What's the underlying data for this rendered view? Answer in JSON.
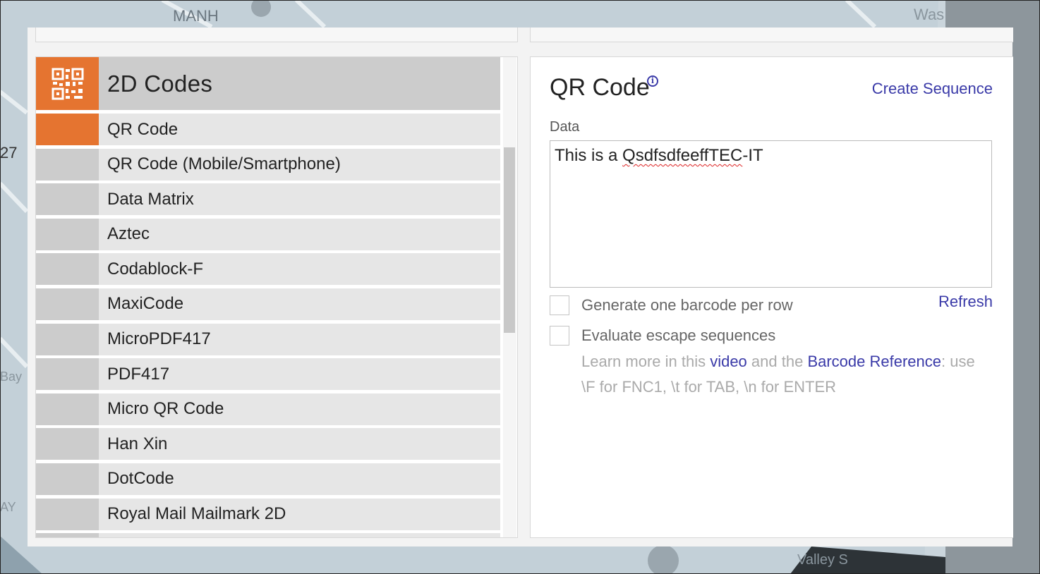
{
  "background": {
    "map_labels": [
      "MANH",
      "27",
      "Was",
      "Valley S",
      "Bay",
      "AY"
    ]
  },
  "category": {
    "title": "2D Codes",
    "icon": "qr-code-icon",
    "accent_color": "#e57430"
  },
  "code_list": [
    {
      "label": "QR Code",
      "selected": true
    },
    {
      "label": "QR Code (Mobile/Smartphone)",
      "selected": false
    },
    {
      "label": "Data Matrix",
      "selected": false
    },
    {
      "label": "Aztec",
      "selected": false
    },
    {
      "label": "Codablock-F",
      "selected": false
    },
    {
      "label": "MaxiCode",
      "selected": false
    },
    {
      "label": "MicroPDF417",
      "selected": false
    },
    {
      "label": "PDF417",
      "selected": false
    },
    {
      "label": "Micro QR Code",
      "selected": false
    },
    {
      "label": "Han Xin",
      "selected": false
    },
    {
      "label": "DotCode",
      "selected": false
    },
    {
      "label": "Royal Mail Mailmark 2D",
      "selected": false
    }
  ],
  "detail": {
    "title": "QR Code",
    "info_icon": "info-icon",
    "create_sequence": "Create Sequence",
    "data_label": "Data",
    "data_value_prefix": "This is a ",
    "data_value_misspelled": "QsdfsdfeeffTEC",
    "data_value_suffix": "-IT",
    "option_one_per_row": "Generate one barcode per row",
    "refresh": "Refresh",
    "option_escape": "Evaluate escape sequences",
    "help_1": "Learn more in this ",
    "help_link_video": "video",
    "help_2": " and the ",
    "help_link_reference": "Barcode Reference",
    "help_3": ": use \\F for FNC1, \\t for TAB, \\n for ENTER",
    "link_color": "#3a3aa8"
  }
}
